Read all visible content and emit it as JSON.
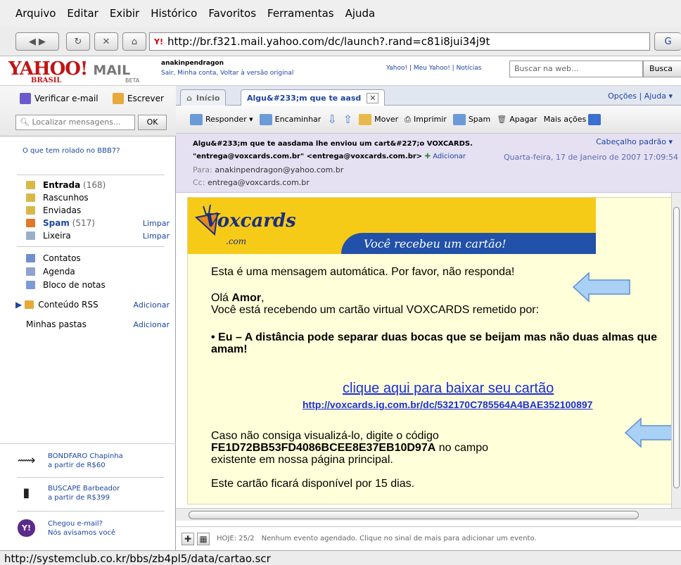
{
  "menu": [
    "Arquivo",
    "Editar",
    "Exibir",
    "Histórico",
    "Favoritos",
    "Ferramentas",
    "Ajuda"
  ],
  "url": "http://br.f321.mail.yahoo.com/dc/launch?.rand=c81i8jui34j9t",
  "header": {
    "logo": "YAHOO!",
    "logo_sub": "BRASIL",
    "mail": "MAIL",
    "beta": "BETA",
    "user": "anakinpendragon",
    "user_links": "Sair, Minha conta, Voltar à versão original",
    "top_links": "Yahoo! | Meu Yahoo! | Notícias",
    "search_placeholder": "Buscar na web...",
    "search_button": "Busca"
  },
  "sidebar": {
    "check_mail": "Verificar e-mail",
    "compose": "Escrever",
    "search_placeholder": "Localizar mensagens...",
    "ok": "OK",
    "promo": "O que tem rolado no BBB7?",
    "folders": [
      {
        "label": "Entrada",
        "count": "(168)",
        "action": ""
      },
      {
        "label": "Rascunhos",
        "count": "",
        "action": ""
      },
      {
        "label": "Enviadas",
        "count": "",
        "action": ""
      },
      {
        "label": "Spam",
        "count": "(517)",
        "action": "Limpar"
      },
      {
        "label": "Lixeira",
        "count": "",
        "action": "Limpar"
      },
      {
        "label": "Contatos",
        "count": "",
        "action": ""
      },
      {
        "label": "Agenda",
        "count": "",
        "action": ""
      },
      {
        "label": "Bloco de notas",
        "count": "",
        "action": ""
      },
      {
        "label": "Conteúdo RSS",
        "count": "",
        "action": "Adicionar"
      },
      {
        "label": "Minhas pastas",
        "count": "",
        "action": "Adicionar"
      }
    ],
    "ads": [
      {
        "line1": "BONDFARO Chapinha",
        "line2": "a partir de R$60"
      },
      {
        "line1": "BUSCAPE Barbeador",
        "line2": "a partir de R$399"
      },
      {
        "line1": "Chegou e-mail?",
        "line2": "Nós avisamos você"
      }
    ]
  },
  "tabs": {
    "home": "Início",
    "msg": "Algu&#233;m que te aasd",
    "options": "Opções | Ajuda ▾"
  },
  "toolbar": {
    "reply": "Responder ▾",
    "forward": "Encaminhar",
    "move": "Mover",
    "print": "Imprimir",
    "spam": "Spam",
    "delete": "Apagar",
    "more": "Mais ações"
  },
  "message": {
    "subject": "Algu&#233;m que te aasdama lhe enviou um cart&#227;o VOXCARDS.",
    "header_mode": "Cabeçalho padrão ▾",
    "from": "\"entrega@voxcards.com.br\" <entrega@voxcards.com.br>",
    "add": "Adicionar",
    "date": "Quarta-feira, 17 de Janeiro de 2007 17:09:54",
    "to_label": "Para:",
    "to": "anakinpendragon@yahoo.com.br",
    "cc_label": "Cc:",
    "cc": "entrega@voxcards.com.br"
  },
  "card": {
    "brand": "Voxcards",
    "brand_com": ".com",
    "banner": "Você recebeu um cartão!",
    "auto": "Esta é uma mensagem automática. Por favor, não responda!",
    "hello": "Olá",
    "name": "Amor",
    "line": "Você está recebendo um cartão virtual VOXCARDS remetido por:",
    "sender": "• Eu – A distância pode separar duas bocas que se beijam mas não duas almas que",
    "sender2": "amam!",
    "link": "clique aqui para baixar seu cartão",
    "link_url": "http://voxcards.ig.com.br/dc/532170C785564A4BAE352100897",
    "code_intro": "Caso não consiga visualizá-lo, digite o código",
    "code": "FE1D72BB53FD4086BCEE8E37EB10D97A",
    "code_after": "no campo",
    "code_line3": "existente em nossa página principal.",
    "days": "Este cartão ficará disponível por 15 dias."
  },
  "agenda": {
    "today": "HOJE: 25/2",
    "text": "Nenhum evento agendado. Clique no sinal de mais para adicionar um evento."
  },
  "status": "http://systemclub.co.kr/bbs/zb4pl5/data/cartao.scr",
  "colors": {
    "accent": "#1c46a0",
    "arrow": "#a9d0f5",
    "banner": "#f6cb18"
  }
}
